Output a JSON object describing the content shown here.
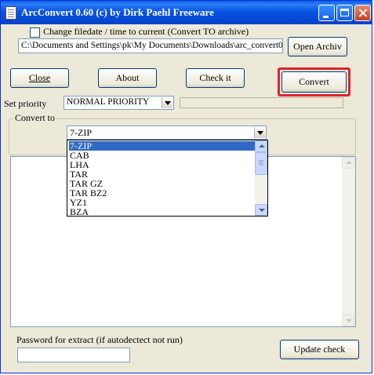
{
  "window": {
    "title": "ArcConvert 0.60 (c) by Dirk Paehl Freeware"
  },
  "options": {
    "change_filedate_label": "Change filedate / time to current (Convert TO archive)",
    "change_filedate_checked": false,
    "archive_path": "C:\\Documents and Settings\\pk\\My Documents\\Downloads\\arc_convert0"
  },
  "buttons": {
    "open_archive": "Open Archiv",
    "close": "Close",
    "about": "About",
    "check_it": "Check it",
    "convert": "Convert",
    "update_check": "Update check"
  },
  "priority": {
    "label": "Set priority",
    "value": "NORMAL PRIORITY"
  },
  "convert_to": {
    "label": "Convert to",
    "value": "7-ZIP",
    "options": [
      "7-ZIP",
      "CAB",
      "LHA",
      "TAR",
      "TAR GZ",
      "TAR BZ2",
      "YZ1",
      "BZA"
    ],
    "highlighted": "7-ZIP"
  },
  "password": {
    "label": "Password for extract (if autodectect not run)",
    "value": ""
  },
  "colors": {
    "titlebar": "#0a5fe6",
    "highlight_box": "#e3212d",
    "selection": "#316ac5"
  }
}
